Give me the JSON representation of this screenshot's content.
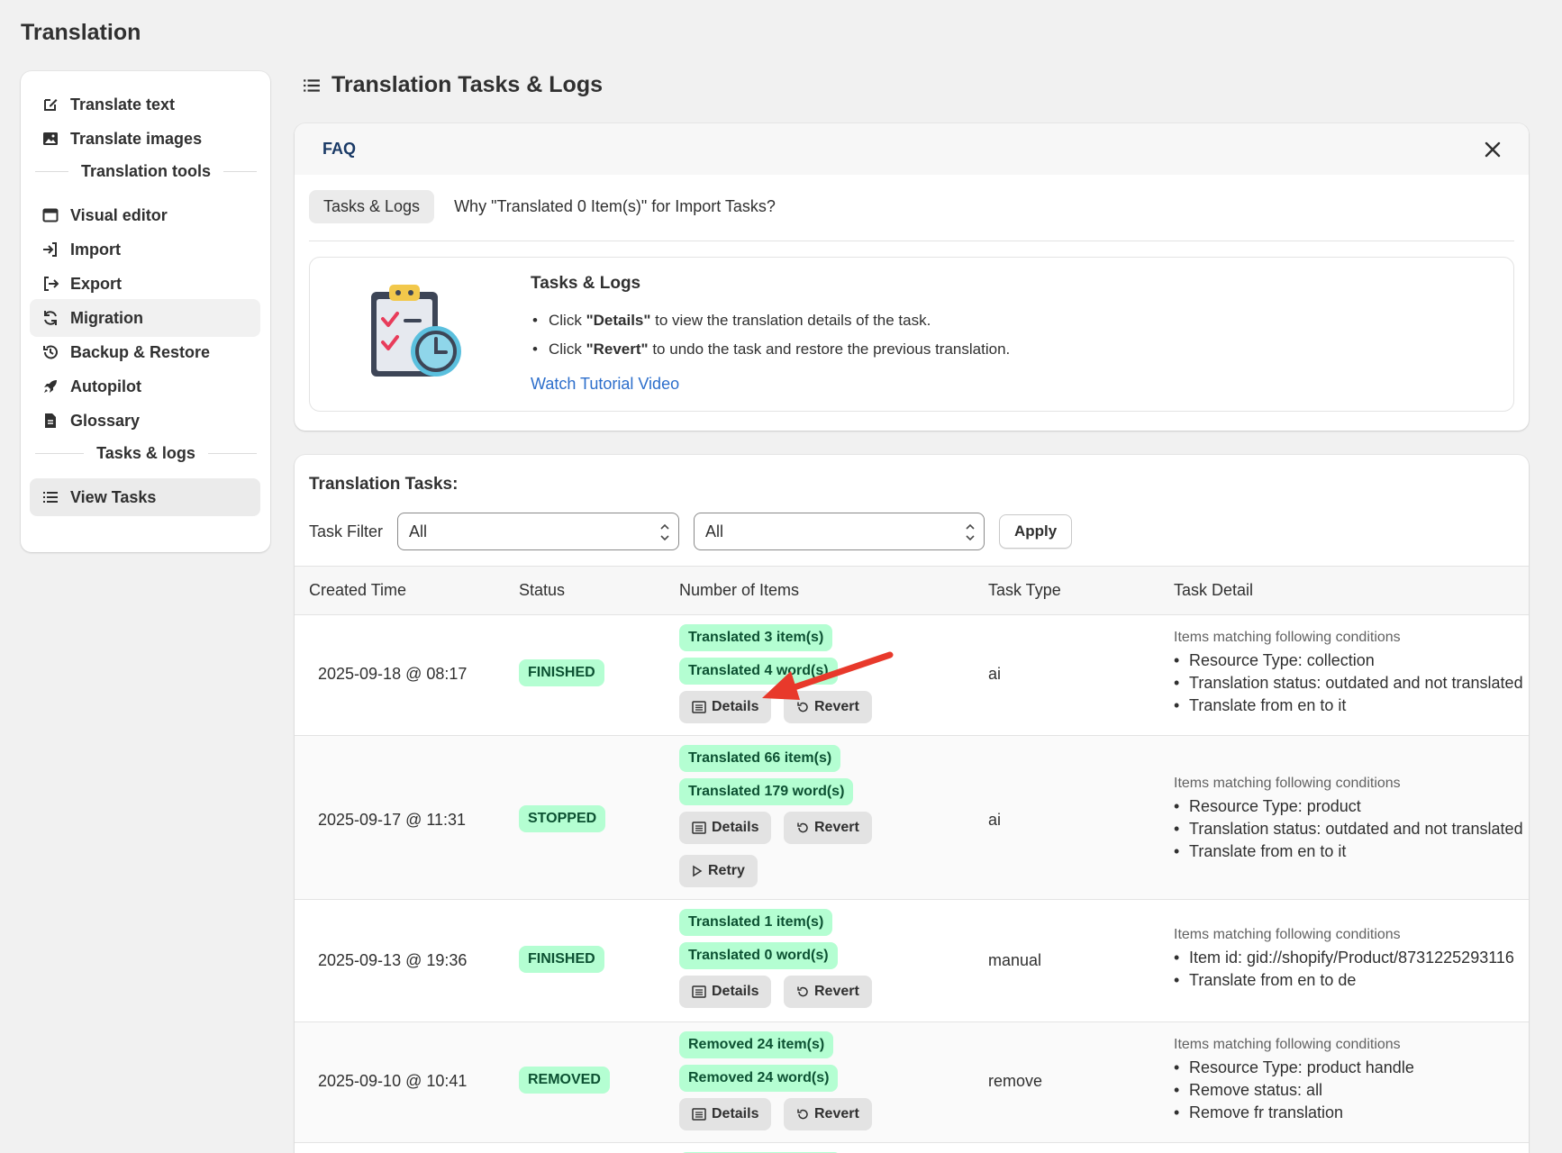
{
  "app": {
    "title": "Translation"
  },
  "sidebar": {
    "items_top": [
      {
        "label": "Translate text",
        "icon": "edit-icon"
      },
      {
        "label": "Translate images",
        "icon": "image-icon"
      }
    ],
    "section_tools": "Translation tools",
    "items_tools": [
      {
        "label": "Visual editor",
        "icon": "window-icon"
      },
      {
        "label": "Import",
        "icon": "import-icon"
      },
      {
        "label": "Export",
        "icon": "export-icon"
      },
      {
        "label": "Migration",
        "icon": "refresh-icon"
      },
      {
        "label": "Backup & Restore",
        "icon": "history-icon"
      },
      {
        "label": "Autopilot",
        "icon": "rocket-icon"
      },
      {
        "label": "Glossary",
        "icon": "document-icon"
      }
    ],
    "section_tasks": "Tasks & logs",
    "items_tasks": [
      {
        "label": "View Tasks",
        "icon": "list-icon"
      }
    ]
  },
  "page": {
    "title": "Translation Tasks & Logs"
  },
  "faq": {
    "title": "FAQ",
    "tabs": [
      "Tasks & Logs",
      "Why \"Translated 0 Item(s)\" for Import Tasks?"
    ],
    "box_title": "Tasks & Logs",
    "bullets": [
      {
        "pre": "Click ",
        "bold": "\"Details\"",
        "post": " to view the translation details of the task."
      },
      {
        "pre": "Click ",
        "bold": "\"Revert\"",
        "post": " to undo the task and restore the previous translation."
      }
    ],
    "link": "Watch Tutorial Video"
  },
  "tasks": {
    "title": "Translation Tasks:",
    "filter_label": "Task Filter",
    "filter1_value": "All",
    "filter2_value": "All",
    "apply_label": "Apply",
    "columns": [
      "Created Time",
      "Status",
      "Number of Items",
      "Task Type",
      "Task Detail"
    ],
    "buttons": {
      "details": "Details",
      "revert": "Revert",
      "retry": "Retry"
    },
    "cond_title": "Items matching following conditions",
    "rows": [
      {
        "time": "2025-09-18 @ 08:17",
        "status": "FINISHED",
        "pill1": "Translated 3 item(s)",
        "pill2": "Translated 4 word(s)",
        "type": "ai",
        "conditions": [
          "Resource Type: collection",
          "Translation status: outdated and not translated",
          "Translate from en to it"
        ]
      },
      {
        "time": "2025-09-17 @ 11:31",
        "status": "STOPPED",
        "pill1": "Translated 66 item(s)",
        "pill2": "Translated 179 word(s)",
        "type": "ai",
        "conditions": [
          "Resource Type: product",
          "Translation status: outdated and not translated",
          "Translate from en to it"
        ]
      },
      {
        "time": "2025-09-13 @ 19:36",
        "status": "FINISHED",
        "pill1": "Translated 1 item(s)",
        "pill2": "Translated 0 word(s)",
        "type": "manual",
        "conditions": [
          "Item id: gid://shopify/Product/8731225293116",
          "Translate from en to de"
        ]
      },
      {
        "time": "2025-09-10 @ 10:41",
        "status": "REMOVED",
        "pill1": "Removed 24 item(s)",
        "pill2": "Removed 24 word(s)",
        "type": "remove",
        "conditions": [
          "Resource Type: product handle",
          "Remove status: all",
          "Remove fr translation"
        ]
      }
    ]
  },
  "colors": {
    "status_bg": "#b4fed2",
    "status_text": "#0c5132",
    "link": "#2c6ecb",
    "annotation_arrow": "#e8392b"
  }
}
